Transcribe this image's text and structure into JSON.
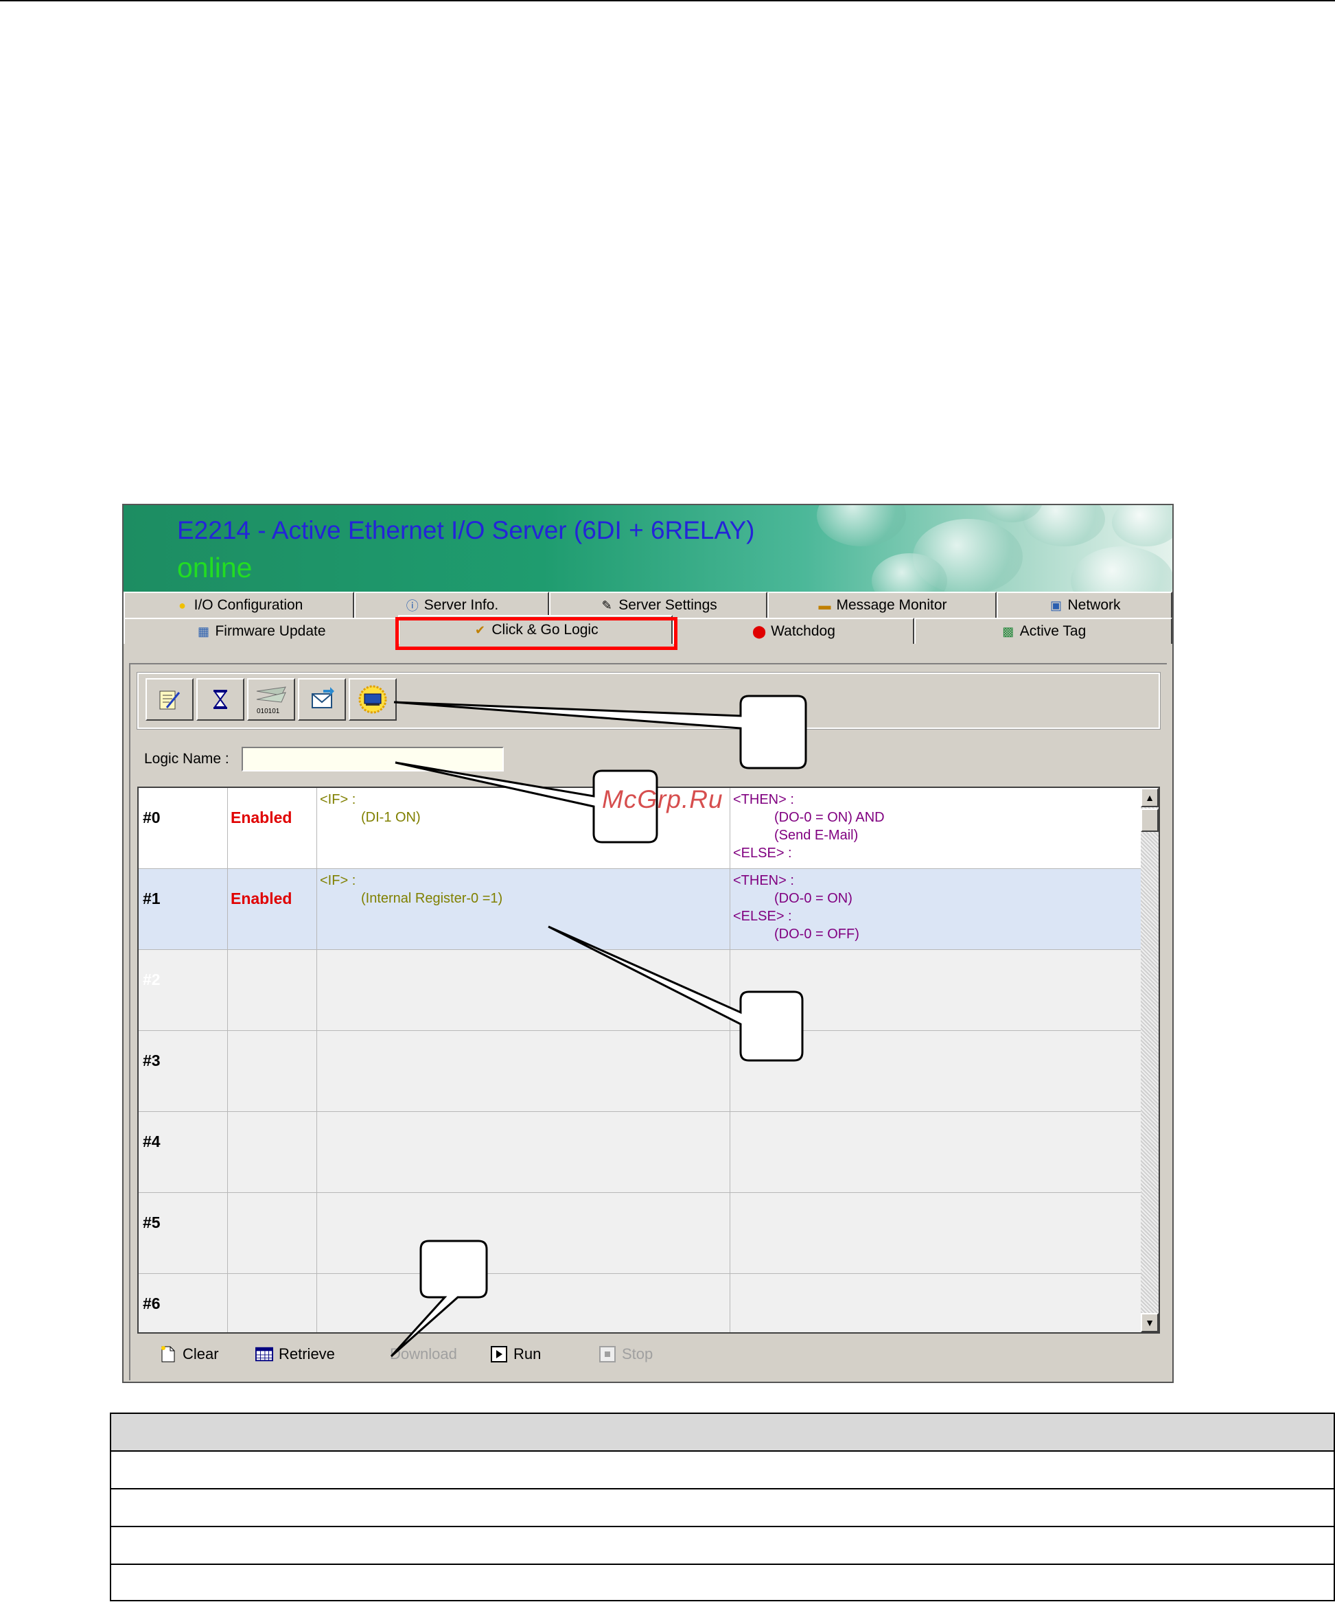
{
  "window": {
    "banner_title": "E2214 - Active Ethernet I/O Server (6DI + 6RELAY)",
    "banner_status": "online"
  },
  "tabs_row1": [
    {
      "label": "I/O Configuration",
      "icon": "lightbulb-icon"
    },
    {
      "label": "Server Info.",
      "icon": "info-icon"
    },
    {
      "label": "Server Settings",
      "icon": "settings-icon"
    },
    {
      "label": "Message Monitor",
      "icon": "monitor-icon"
    },
    {
      "label": "Network",
      "icon": "network-icon"
    }
  ],
  "tabs_row2": [
    {
      "label": "Firmware Update",
      "icon": "firmware-icon"
    },
    {
      "label": "Click & Go Logic",
      "icon": "logic-icon",
      "active": true
    },
    {
      "label": "Watchdog",
      "icon": "watchdog-icon"
    },
    {
      "label": "Active Tag",
      "icon": "tag-icon"
    }
  ],
  "toolbar": {
    "buttons": [
      "edit-icon",
      "timer-icon",
      "binary-icon",
      "email-icon",
      "server-icon"
    ],
    "binary_label": "010101"
  },
  "logic_name": {
    "label": "Logic Name :",
    "value": ""
  },
  "rules": [
    {
      "id": "#0",
      "status": "Enabled",
      "if_head": "<IF> :",
      "if_lines": [
        "(DI-1 ON)"
      ],
      "then_lines": [
        "<THEN> :",
        "(DO-0 = ON)  AND",
        "(Send E-Mail)",
        "<ELSE> :"
      ]
    },
    {
      "id": "#1",
      "status": "Enabled",
      "if_head": "<IF> :",
      "if_lines": [
        "(Internal Register-0 =1)"
      ],
      "then_lines": [
        "<THEN> :",
        "(DO-0 = ON)",
        "<ELSE> :",
        "(DO-0 = OFF)"
      ]
    },
    {
      "id": "#2",
      "status": ""
    },
    {
      "id": "#3",
      "status": ""
    },
    {
      "id": "#4",
      "status": ""
    },
    {
      "id": "#5",
      "status": ""
    },
    {
      "id": "#6",
      "status": ""
    }
  ],
  "bottom_buttons": [
    {
      "label": "Clear",
      "icon": "clear-icon",
      "enabled": true
    },
    {
      "label": "Retrieve",
      "icon": "retrieve-icon",
      "enabled": true
    },
    {
      "label": "Download",
      "icon": "",
      "enabled": false
    },
    {
      "label": "Run",
      "icon": "run-icon",
      "enabled": true
    },
    {
      "label": "Stop",
      "icon": "stop-icon",
      "enabled": false
    }
  ],
  "watermark": "McGrp.Ru",
  "colors": {
    "enabled": "#e00000",
    "if_text": "#808000",
    "then_text": "#800080",
    "selected_row": "#dbe5f5",
    "highlight": "#ff0000"
  }
}
